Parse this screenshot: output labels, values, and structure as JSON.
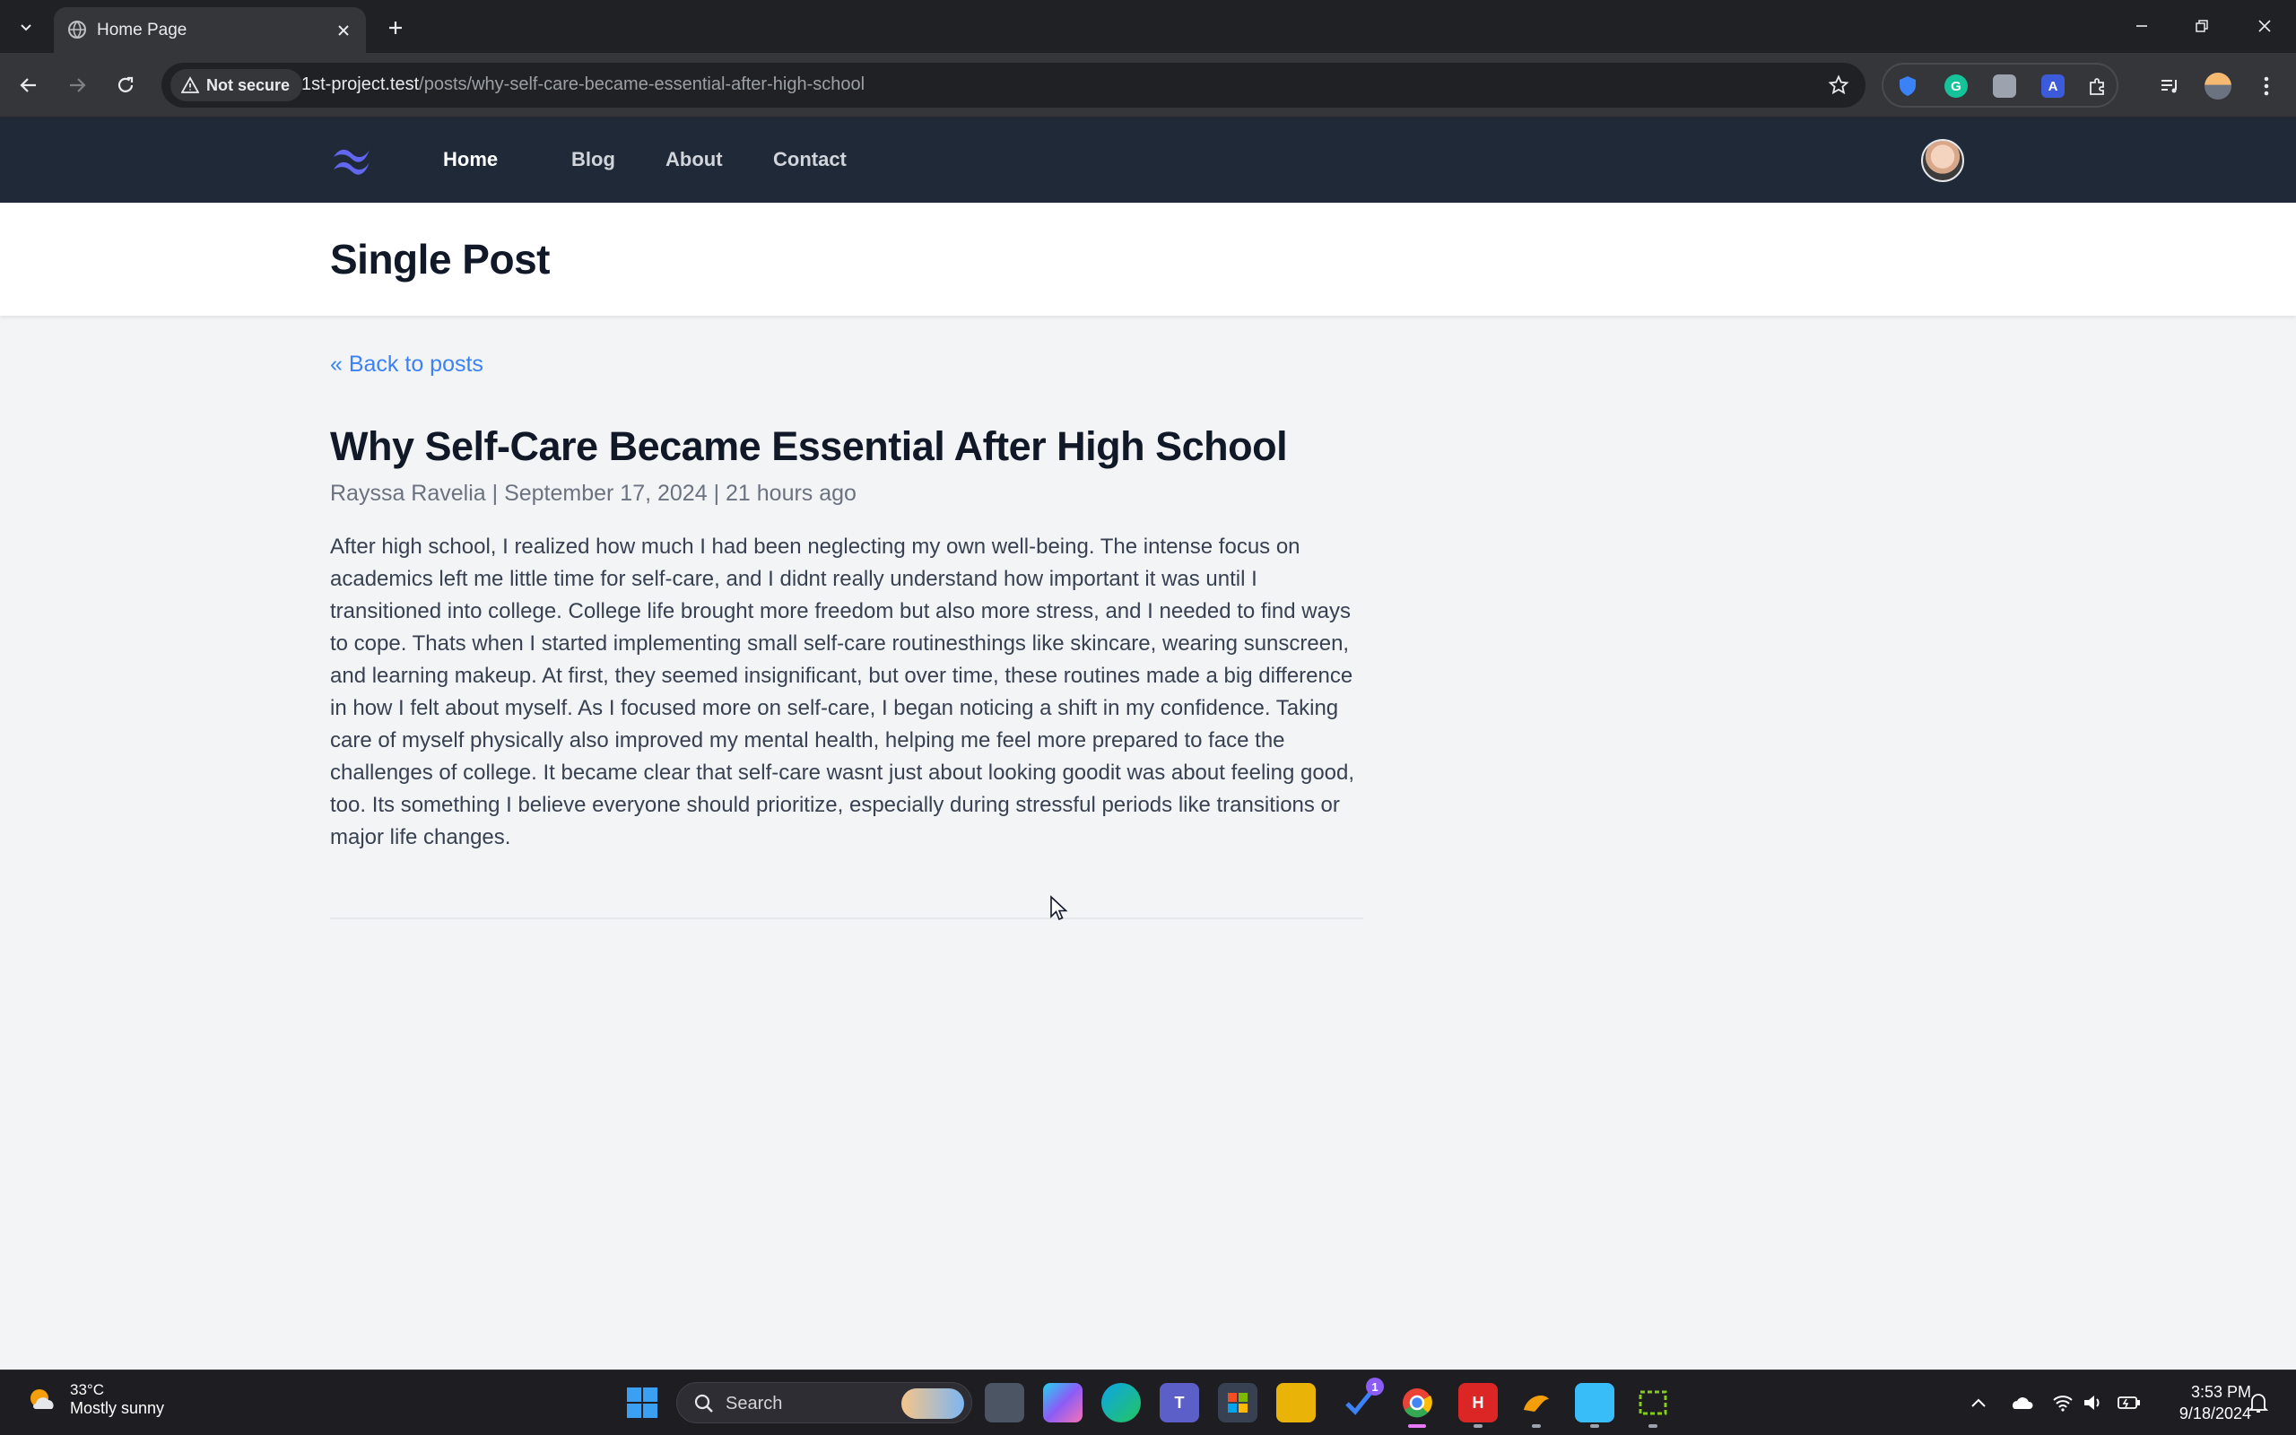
{
  "browser": {
    "tab_title": "Home Page",
    "security_label": "Not secure",
    "url_host": "1st-project.test",
    "url_path": "/posts/why-self-care-became-essential-after-high-school"
  },
  "site_nav": {
    "links": [
      "Home",
      "Blog",
      "About",
      "Contact"
    ],
    "active": "Home"
  },
  "header": {
    "title": "Single Post"
  },
  "post": {
    "back_label": "« Back to posts",
    "title": "Why Self-Care Became Essential After High School",
    "meta": "Rayssa Ravelia | September 17, 2024 | 21 hours ago",
    "body": "After high school, I realized how much I had been neglecting my own well-being. The intense focus on academics left me little time for self-care, and I didnt really understand how important it was until I transitioned into college. College life brought more freedom but also more stress, and I needed to find ways to cope. Thats when I started implementing small self-care routinesthings like skincare, wearing sunscreen, and learning makeup. At first, they seemed insignificant, but over time, these routines made a big difference in how I felt about myself. As I focused more on self-care, I began noticing a shift in my confidence. Taking care of myself physically also improved my mental health, helping me feel more prepared to face the challenges of college. It became clear that self-care wasnt just about looking goodit was about feeling good, too. Its something I believe everyone should prioritize, especially during stressful periods like transitions or major life changes."
  },
  "taskbar": {
    "weather_temp": "33°C",
    "weather_desc": "Mostly sunny",
    "search_label": "Search",
    "notification_count": "1",
    "time": "3:53 PM",
    "date": "9/18/2024"
  },
  "colors": {
    "nav_bg": "#1f2937",
    "link": "#3b82f6",
    "page_bg": "#f3f4f6",
    "logo": "#6366f1"
  }
}
